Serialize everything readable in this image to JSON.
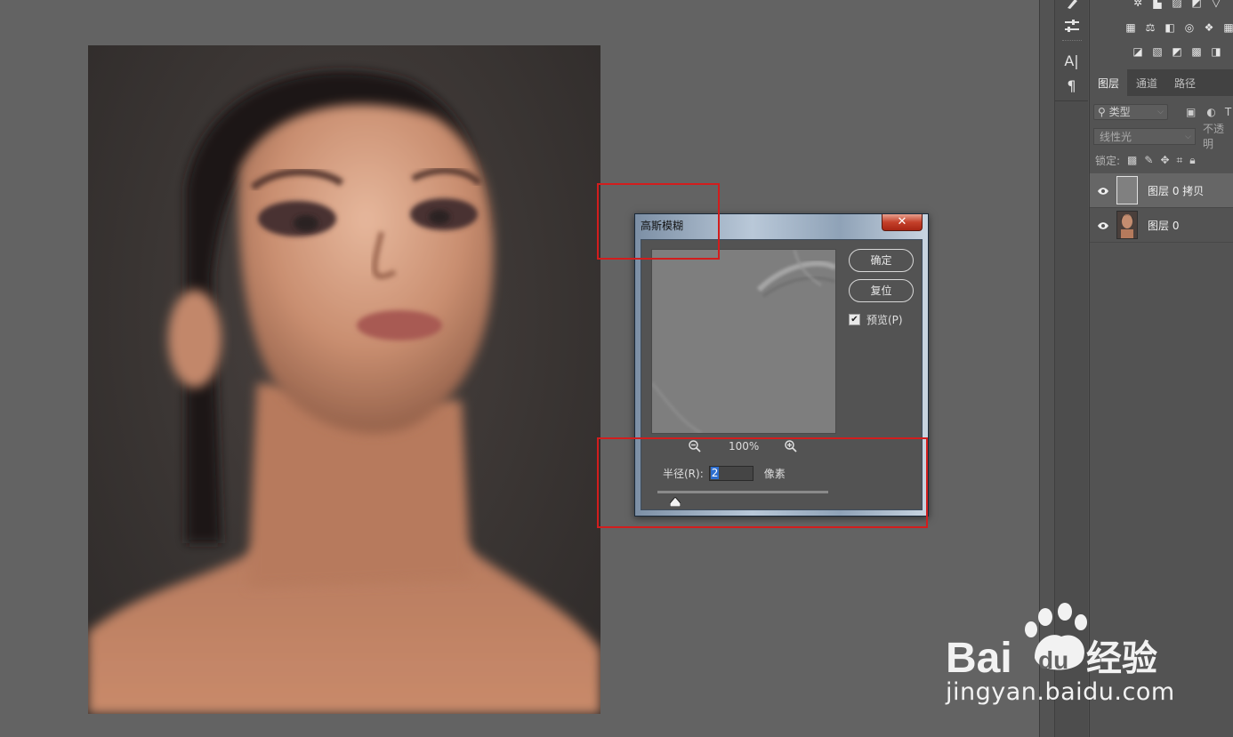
{
  "dialog": {
    "title": "高斯模糊",
    "close_glyph": "✕",
    "ok_label": "确定",
    "reset_label": "复位",
    "preview_label": "预览(P)",
    "preview_checked": true,
    "zoom_level": "100%",
    "radius_label": "半径(R):",
    "radius_value": "2",
    "radius_unit": "像素"
  },
  "tool_strip": {
    "icons": [
      "brush-settings-icon",
      "adjustments-icon",
      "character-icon",
      "paragraph-icon"
    ],
    "character_glyph": "A|",
    "paragraph_glyph": "¶"
  },
  "layers_panel": {
    "tabs": [
      "图层",
      "通道",
      "路径"
    ],
    "active_tab": "图层",
    "filter_label": "类型",
    "blend_mode": "线性光",
    "opacity_label": "不透明",
    "lock_label": "锁定:",
    "layers": [
      {
        "name": "图层 0 拷贝",
        "selected": true,
        "visible": true,
        "thumbnail": "gray"
      },
      {
        "name": "图层 0",
        "selected": false,
        "visible": true,
        "thumbnail": "portrait"
      }
    ]
  },
  "watermark": {
    "brand": "Bai du 经验",
    "url": "jingyan.baidu.com"
  },
  "colors": {
    "workspace_bg": "#636363",
    "panel_bg": "#535353",
    "annotation_red": "#d21d1d",
    "selection_blue": "#2f6fd0"
  }
}
